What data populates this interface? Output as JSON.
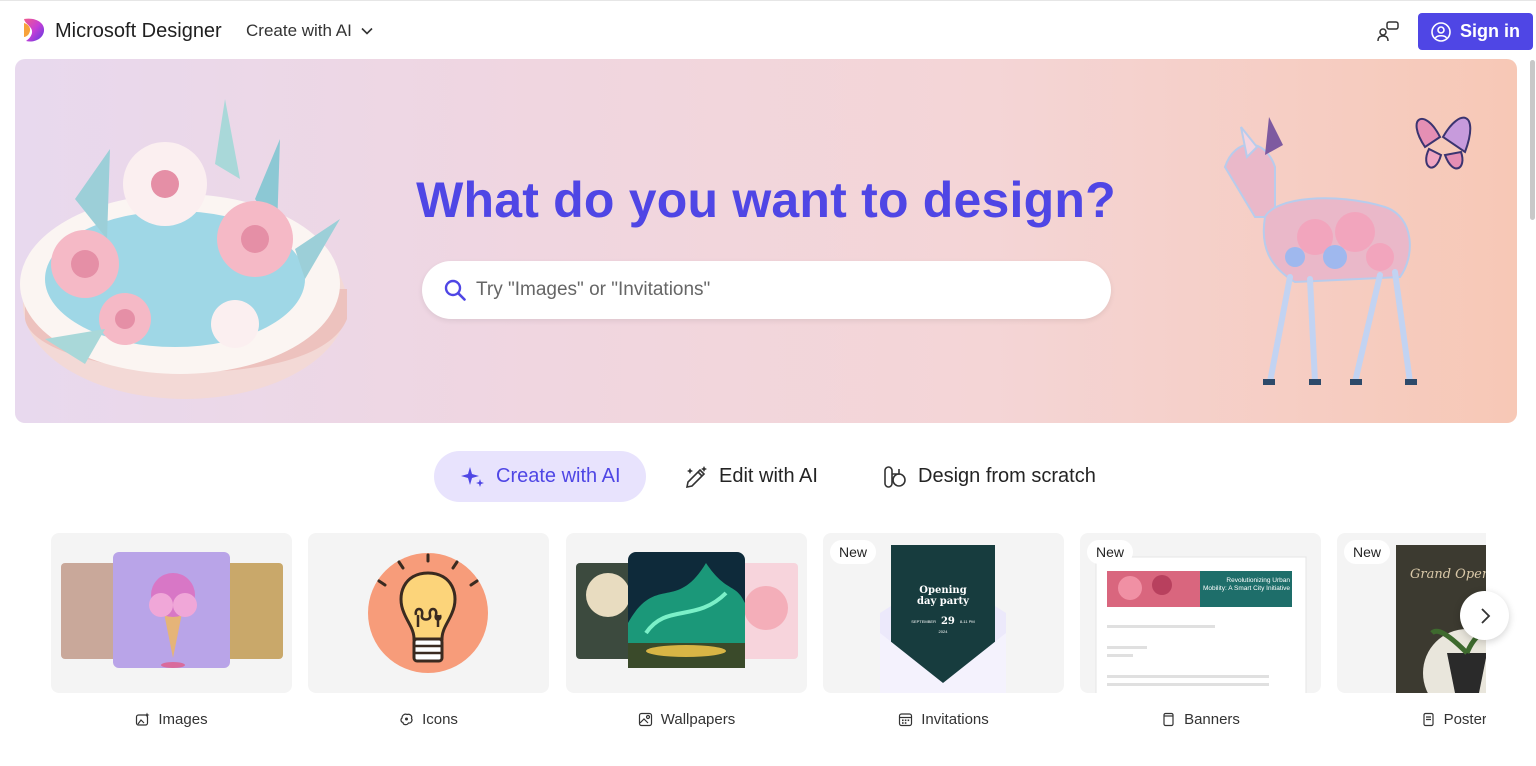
{
  "header": {
    "brand": "Microsoft Designer",
    "create_menu_label": "Create with AI",
    "sign_in_label": "Sign in",
    "accent_color": "#4f46e5"
  },
  "hero": {
    "title": "What do you want to design?",
    "search_placeholder": "Try \"Images\" or \"Invitations\""
  },
  "tabs": [
    {
      "label": "Create with AI",
      "icon": "sparkle-icon",
      "active": true
    },
    {
      "label": "Edit with AI",
      "icon": "magic-pen-icon",
      "active": false
    },
    {
      "label": "Design from scratch",
      "icon": "design-scratch-icon",
      "active": false
    }
  ],
  "cards": [
    {
      "label": "Images",
      "icon": "image-sparkle-icon",
      "badge": ""
    },
    {
      "label": "Icons",
      "icon": "icons-icon",
      "badge": ""
    },
    {
      "label": "Wallpapers",
      "icon": "wallpaper-icon",
      "badge": ""
    },
    {
      "label": "Invitations",
      "icon": "calendar-icon",
      "badge": "New",
      "preview_title": "Opening day party",
      "preview_month": "SEPTEMBER",
      "preview_day": "29",
      "preview_time": "8-11 PM",
      "preview_year": "2024"
    },
    {
      "label": "Banners",
      "icon": "banner-icon",
      "badge": "New",
      "preview_headline": "Revolutionizing Urban Mobility: A Smart City Initiative"
    },
    {
      "label": "Posters",
      "icon": "poster-icon",
      "badge": "New",
      "preview_headline": "Grand Opening"
    }
  ]
}
